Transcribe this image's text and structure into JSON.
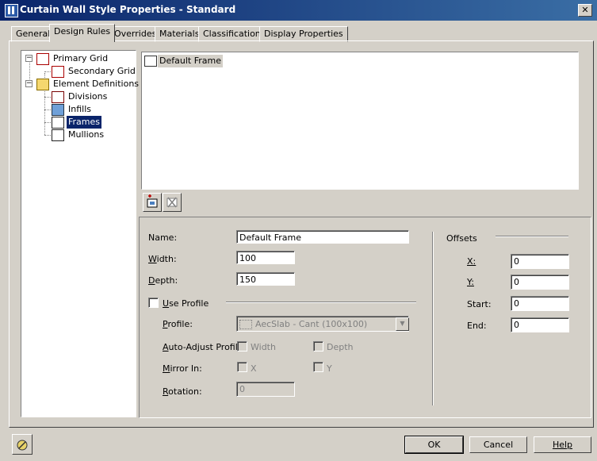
{
  "window": {
    "title": "Curtain Wall Style Properties - Standard",
    "close": "✕"
  },
  "tabs": [
    {
      "label": "General"
    },
    {
      "label": "Design Rules"
    },
    {
      "label": "Overrides"
    },
    {
      "label": "Materials"
    },
    {
      "label": "Classifications"
    },
    {
      "label": "Display Properties"
    }
  ],
  "tree": {
    "items": [
      {
        "label": "Primary Grid"
      },
      {
        "label": "Secondary Grid"
      },
      {
        "label": "Element Definitions"
      },
      {
        "label": "Divisions"
      },
      {
        "label": "Infills"
      },
      {
        "label": "Frames"
      },
      {
        "label": "Mullions"
      }
    ],
    "expander_minus": "−"
  },
  "list": {
    "items": [
      {
        "label": "Default Frame"
      }
    ]
  },
  "props": {
    "name_label": "Name:",
    "name_value": "Default Frame",
    "width_label_u": "W",
    "width_label_rest": "idth:",
    "width_value": "100",
    "depth_label_u": "D",
    "depth_label_rest": "epth:",
    "depth_value": "150",
    "use_profile_u": "U",
    "use_profile_rest": "se Profile",
    "profile_label_u": "P",
    "profile_label_rest": "rofile:",
    "profile_value": "AecSlab - Cant (100x100)",
    "auto_adjust_label_u": "A",
    "auto_adjust_label_rest": "uto-Adjust Profile:",
    "auto_width": "Width",
    "auto_depth": "Depth",
    "mirror_label_u": "M",
    "mirror_label_rest": "irror In:",
    "mirror_x": "X",
    "mirror_y": "Y",
    "rotation_label_u": "R",
    "rotation_label_rest": "otation:",
    "rotation_value": "0"
  },
  "offsets": {
    "title": "Offsets",
    "x_label": "X:",
    "x_value": "0",
    "y_label": "Y:",
    "y_value": "0",
    "start_label": "Start:",
    "start_value": "0",
    "end_label": "End:",
    "end_value": "0"
  },
  "buttons": {
    "ok": "OK",
    "cancel": "Cancel",
    "help": "Help"
  }
}
